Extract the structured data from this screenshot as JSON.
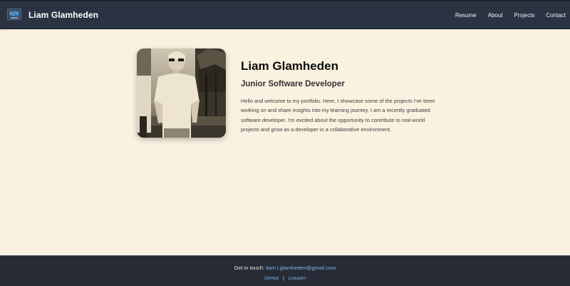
{
  "navbar": {
    "brand": "Liam Glamheden",
    "logo_icon": "code-monitor-icon",
    "logo_glyph": "</>",
    "links": [
      {
        "label": "Resume"
      },
      {
        "label": "About"
      },
      {
        "label": "Projects"
      },
      {
        "label": "Contact"
      }
    ]
  },
  "hero": {
    "name": "Liam Glamheden",
    "role": "Junior Software Developer",
    "intro": "Hello and welcome to my portfolio. Here, I showcase some of the projects I've been working on and share insights into my learning journey. I am a recently graduated software developer. I'm excited about the opportunity to contribute to real-world projects and grow as a developer in a collaborative environment."
  },
  "footer": {
    "contact_prefix": "Get in touch:",
    "email": "liam.l.glamheden@gmail.com",
    "links": [
      {
        "label": "GitHub"
      },
      {
        "label": "LinkedIn"
      }
    ],
    "separator": "|"
  },
  "colors": {
    "page_background": "#faf1e0",
    "navbar_background": "#2b3343",
    "footer_background": "#262b35",
    "link_accent": "#86b7ea"
  }
}
